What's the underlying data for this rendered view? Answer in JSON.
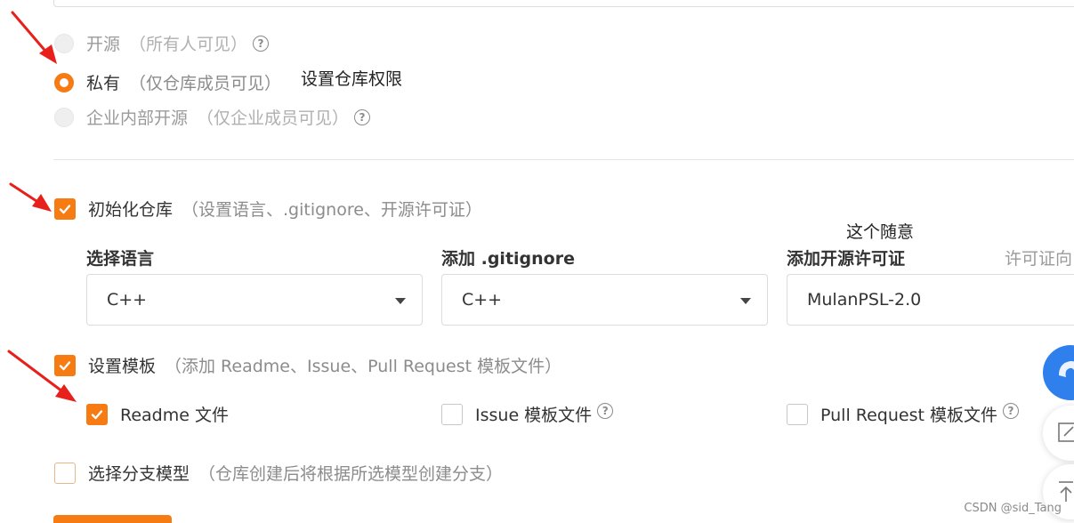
{
  "visibility": {
    "options": [
      {
        "label": "开源",
        "hint": "（所有人可见）",
        "state": "disabled"
      },
      {
        "label": "私有",
        "hint": "（仅仓库成员可见）",
        "state": "selected"
      },
      {
        "label": "企业内部开源",
        "hint": "（仅企业成员可见）",
        "state": "disabled"
      }
    ],
    "annotation": "设置仓库权限"
  },
  "init_repo": {
    "label": "初始化仓库",
    "hint": "（设置语言、.gitignore、开源许可证）",
    "checked": true,
    "annotation": "这个随意",
    "language": {
      "label": "选择语言",
      "value": "C++"
    },
    "gitignore": {
      "label": "添加 .gitignore",
      "value": "C++"
    },
    "license": {
      "label": "添加开源许可证",
      "value": "MulanPSL-2.0"
    },
    "license_hint": "许可证向"
  },
  "template": {
    "label": "设置模板",
    "hint": "（添加 Readme、Issue、Pull Request 模板文件）",
    "checked": true,
    "items": [
      {
        "label": "Readme 文件",
        "checked": true
      },
      {
        "label": "Issue 模板文件",
        "checked": false
      },
      {
        "label": "Pull Request 模板文件",
        "checked": false
      }
    ]
  },
  "branch_model": {
    "label": "选择分支模型",
    "hint": "（仓库创建后将根据所选模型创建分支）",
    "checked": false
  },
  "watermark": "CSDN @sid_Tang",
  "colors": {
    "accent": "#f57b12",
    "arrow": "#e8201c",
    "float_blue": "#2f80ed"
  }
}
